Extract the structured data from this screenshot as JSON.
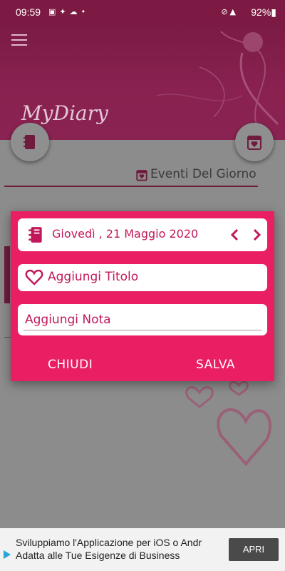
{
  "status_bar": {
    "time": "09:59",
    "battery": "92%",
    "left_icons": [
      "image-icon",
      "twitter-icon",
      "weather-icon",
      "dot-icon"
    ],
    "right_icons": [
      "no-sim-icon",
      "4g-signal-icon",
      "battery-icon"
    ]
  },
  "header": {
    "app_title": "MyDiary"
  },
  "page": {
    "events_title": "Eventi Del Giorno"
  },
  "dialog": {
    "date": "Giovedì , 21 Maggio 2020",
    "title_placeholder": "Aggiungi Titolo",
    "note_placeholder": "Aggiungi Nota",
    "close_label": "CHIUDI",
    "save_label": "SALVA"
  },
  "ad": {
    "line1": "Sviluppiamo l'Applicazione per iOS o Andr",
    "line2": "Adatta alle Tue Esigenze di Business",
    "button": "APRI"
  },
  "colors": {
    "accent": "#e91e63",
    "accent_text": "#c2185b",
    "header_dim": "#7b1b45"
  }
}
